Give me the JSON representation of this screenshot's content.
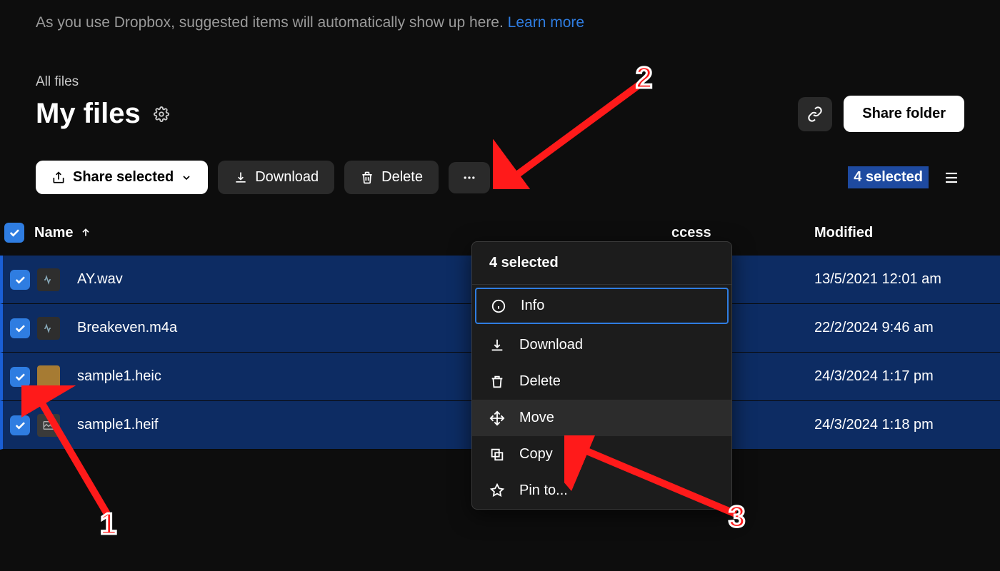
{
  "hint": {
    "text": "As you use Dropbox, suggested items will automatically show up here. ",
    "link": "Learn more"
  },
  "breadcrumb": "All files",
  "title": "My files",
  "share_folder": "Share folder",
  "toolbar": {
    "share_selected": "Share selected",
    "download": "Download",
    "delete": "Delete"
  },
  "selection_badge": "4 selected",
  "columns": {
    "name": "Name",
    "access": "ccess",
    "modified": "Modified"
  },
  "rows": [
    {
      "name": "AY.wav",
      "icon": "audio",
      "modified": "13/5/2021 12:01 am"
    },
    {
      "name": "Breakeven.m4a",
      "icon": "audio",
      "modified": "22/2/2024 9:46 am"
    },
    {
      "name": "sample1.heic",
      "icon": "photo",
      "modified": "24/3/2024 1:17 pm"
    },
    {
      "name": "sample1.heif",
      "icon": "image",
      "modified": "24/3/2024 1:18 pm"
    }
  ],
  "menu": {
    "title": "4 selected",
    "items": {
      "info": "Info",
      "download": "Download",
      "delete": "Delete",
      "move": "Move",
      "copy": "Copy",
      "pin": "Pin to..."
    }
  },
  "annotations": {
    "n1": "1",
    "n2": "2",
    "n3": "3"
  }
}
